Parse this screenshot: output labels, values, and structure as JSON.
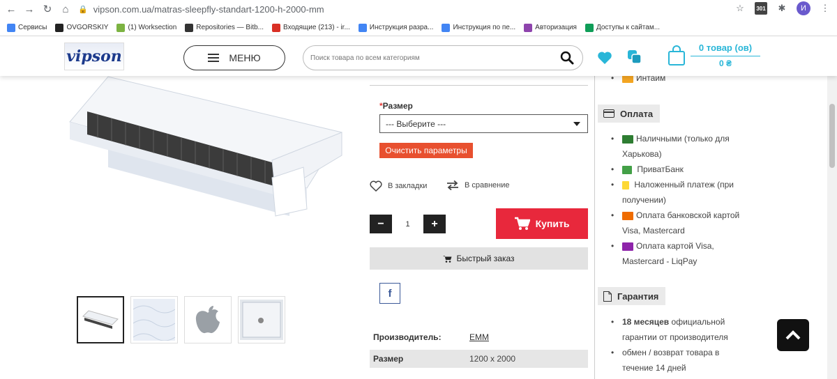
{
  "browser": {
    "url": "vipson.com.ua/matras-sleepfly-standart-1200-h-2000-mm",
    "profile_initial": "И",
    "ext_badge": "301",
    "bookmarks": [
      {
        "label": "Сервисы",
        "color": "#4285f4"
      },
      {
        "label": "OVGORSKIY",
        "color": "#222222"
      },
      {
        "label": "(1) Worksection",
        "color": "#7cb342"
      },
      {
        "label": "Repositories — Bitb...",
        "color": "#333333"
      },
      {
        "label": "Входящие (213) - ir...",
        "color": "#d93025"
      },
      {
        "label": "Инструкция разра...",
        "color": "#4285f4"
      },
      {
        "label": "Инструкция по пе...",
        "color": "#4285f4"
      },
      {
        "label": "Авторизация",
        "color": "#8e44ad"
      },
      {
        "label": "Доступы к сайтам...",
        "color": "#0f9d58"
      }
    ]
  },
  "header": {
    "logo_text": "vipson",
    "menu_label": "МЕНЮ",
    "search_placeholder": "Поиск товара по всем категориям",
    "cart_count": "0 товар (ов)",
    "cart_sum": "0 ₴",
    "accent": "#29b6d8"
  },
  "product": {
    "size_label": "Размер",
    "size_required_mark": "*",
    "size_select_value": "--- Выберите ---",
    "clear_label": "Очистить параметры",
    "wishlist_label": "В закладки",
    "compare_label": "В сравнение",
    "quantity": "1",
    "buy_label": "Купить",
    "quick_order_label": "Быстрый заказ",
    "facebook_label": "f",
    "specs": [
      {
        "key": "Производитель:",
        "value": "EMM"
      },
      {
        "key": "Размер",
        "value": "1200 x 2000"
      }
    ],
    "buy_color": "#e8283c",
    "clear_color": "#e8502f"
  },
  "sidebar": {
    "top_item": "Интайм",
    "payment_title": "Оплата",
    "payment_items": [
      {
        "label": "Наличными (только для Харькова)"
      },
      {
        "label": " ПриватБанк"
      },
      {
        "label": " Наложенный платеж (при получении)"
      },
      {
        "label": "Оплата банковской картой Visa, Mastercard"
      },
      {
        "label": "Оплата картой Visa, Mastercard - LiqPay"
      }
    ],
    "warranty_title": "Гарантия",
    "warranty_bold": "18 месяцев",
    "warranty_rest": " официальной гарантии от производителя",
    "return_text": "обмен / возврат товара в течение 14 дней"
  }
}
